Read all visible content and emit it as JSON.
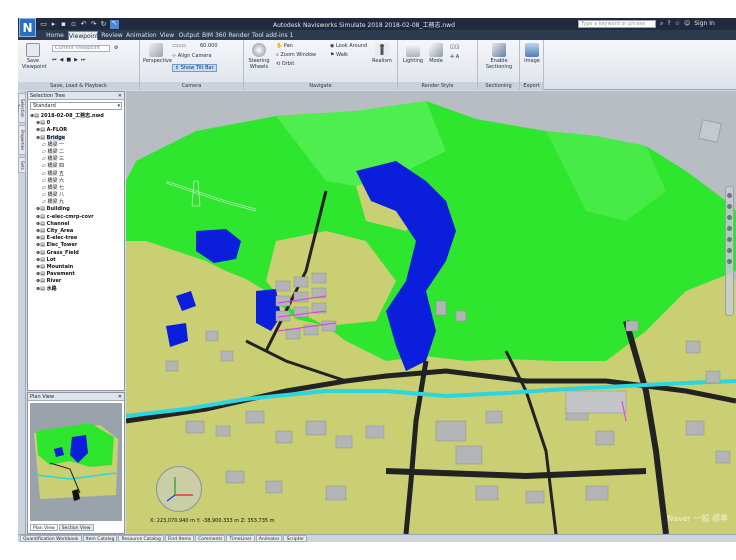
{
  "app": {
    "title": "Autodesk Navisworks Simulate 2018   2018-02-08_工務志.nwd",
    "logo": "N",
    "search_placeholder": "Type a keyword or phrase",
    "sign_in": "Sign In"
  },
  "ribbon_tabs": [
    "Home",
    "Viewpoint",
    "Review",
    "Animation",
    "View",
    "Output",
    "BIM 360",
    "Render",
    "Tool add-ins 1"
  ],
  "active_tab": "Viewpoint",
  "ribbon": {
    "save_viewpoint": "Save Viewpoint",
    "viewpoint_combo": "Current Viewpoint",
    "group_save": "Save, Load & Playback",
    "perspective": "Perspective",
    "align_camera": "Align Camera",
    "show_tilt": "Show Tilt Bar",
    "fov_value": "60.000",
    "group_camera": "Camera",
    "steering_wheels": "Steering Wheels",
    "pan": "Pan",
    "zoom_window": "Zoom Window",
    "orbit": "Orbit",
    "look_around": "Look Around",
    "walk": "Walk",
    "realism": "Realism",
    "group_navigate": "Navigate",
    "lighting": "Lighting",
    "mode": "Mode",
    "group_render": "Render Style",
    "enable_sectioning": "Enable Sectioning",
    "group_sectioning": "Sectioning",
    "image": "Image",
    "group_export": "Export"
  },
  "left_tabs": [
    "Selection Tree",
    "Properties",
    "Sets"
  ],
  "selection_tree": {
    "title": "Selection Tree",
    "mode": "Standard",
    "items": [
      {
        "label": "2018-02-08_工務志.nwd",
        "level": 0,
        "sel": false
      },
      {
        "label": "0",
        "level": 1,
        "sel": false
      },
      {
        "label": "A-FLOR",
        "level": 1,
        "sel": false
      },
      {
        "label": "Bridge",
        "level": 1,
        "sel": true
      },
      {
        "label": "橋梁 一",
        "level": 2,
        "sel": false
      },
      {
        "label": "橋梁 二",
        "level": 2,
        "sel": false
      },
      {
        "label": "橋梁 三",
        "level": 2,
        "sel": false
      },
      {
        "label": "橋梁 四",
        "level": 2,
        "sel": false
      },
      {
        "label": "橋梁 五",
        "level": 2,
        "sel": false
      },
      {
        "label": "橋梁 六",
        "level": 2,
        "sel": false
      },
      {
        "label": "橋梁 七",
        "level": 2,
        "sel": false
      },
      {
        "label": "橋梁 八",
        "level": 2,
        "sel": false
      },
      {
        "label": "橋梁 九",
        "level": 2,
        "sel": false
      },
      {
        "label": "Building",
        "level": 1,
        "sel": false
      },
      {
        "label": "c-elec-cmrp-covr",
        "level": 1,
        "sel": false
      },
      {
        "label": "Channel",
        "level": 1,
        "sel": false
      },
      {
        "label": "City_Area",
        "level": 1,
        "sel": false
      },
      {
        "label": "E-elec-tree",
        "level": 1,
        "sel": false
      },
      {
        "label": "Elec_Tower",
        "level": 1,
        "sel": false
      },
      {
        "label": "Grass_Field",
        "level": 1,
        "sel": false
      },
      {
        "label": "Lot",
        "level": 1,
        "sel": false
      },
      {
        "label": "Mountain",
        "level": 1,
        "sel": false
      },
      {
        "label": "Pavement",
        "level": 1,
        "sel": false
      },
      {
        "label": "River",
        "level": 1,
        "sel": false
      },
      {
        "label": "水路",
        "level": 1,
        "sel": false
      }
    ]
  },
  "plan_view": {
    "title": "Plan View",
    "tabs": [
      "Plan View",
      "Section View"
    ]
  },
  "viewport": {
    "coordinates": "X: 223,070.940 m  Y: -38,900.333 m  Z: 353.735 m",
    "watermark": "Naver 一般 標準"
  },
  "bottom_tabs": [
    "Quantification Workbook",
    "Item Catalog",
    "Resource Catalog",
    "Find Items",
    "Comments",
    "TimeLiner",
    "Animator",
    "Scripter"
  ],
  "colors": {
    "mountain": "#2ee62e",
    "ground": "#c9cf72",
    "water": "#0a1edc",
    "river": "#2ad6e0",
    "road": "#1e1e1e",
    "building": "#b2b4b6",
    "accent": "#2a6fbf"
  }
}
